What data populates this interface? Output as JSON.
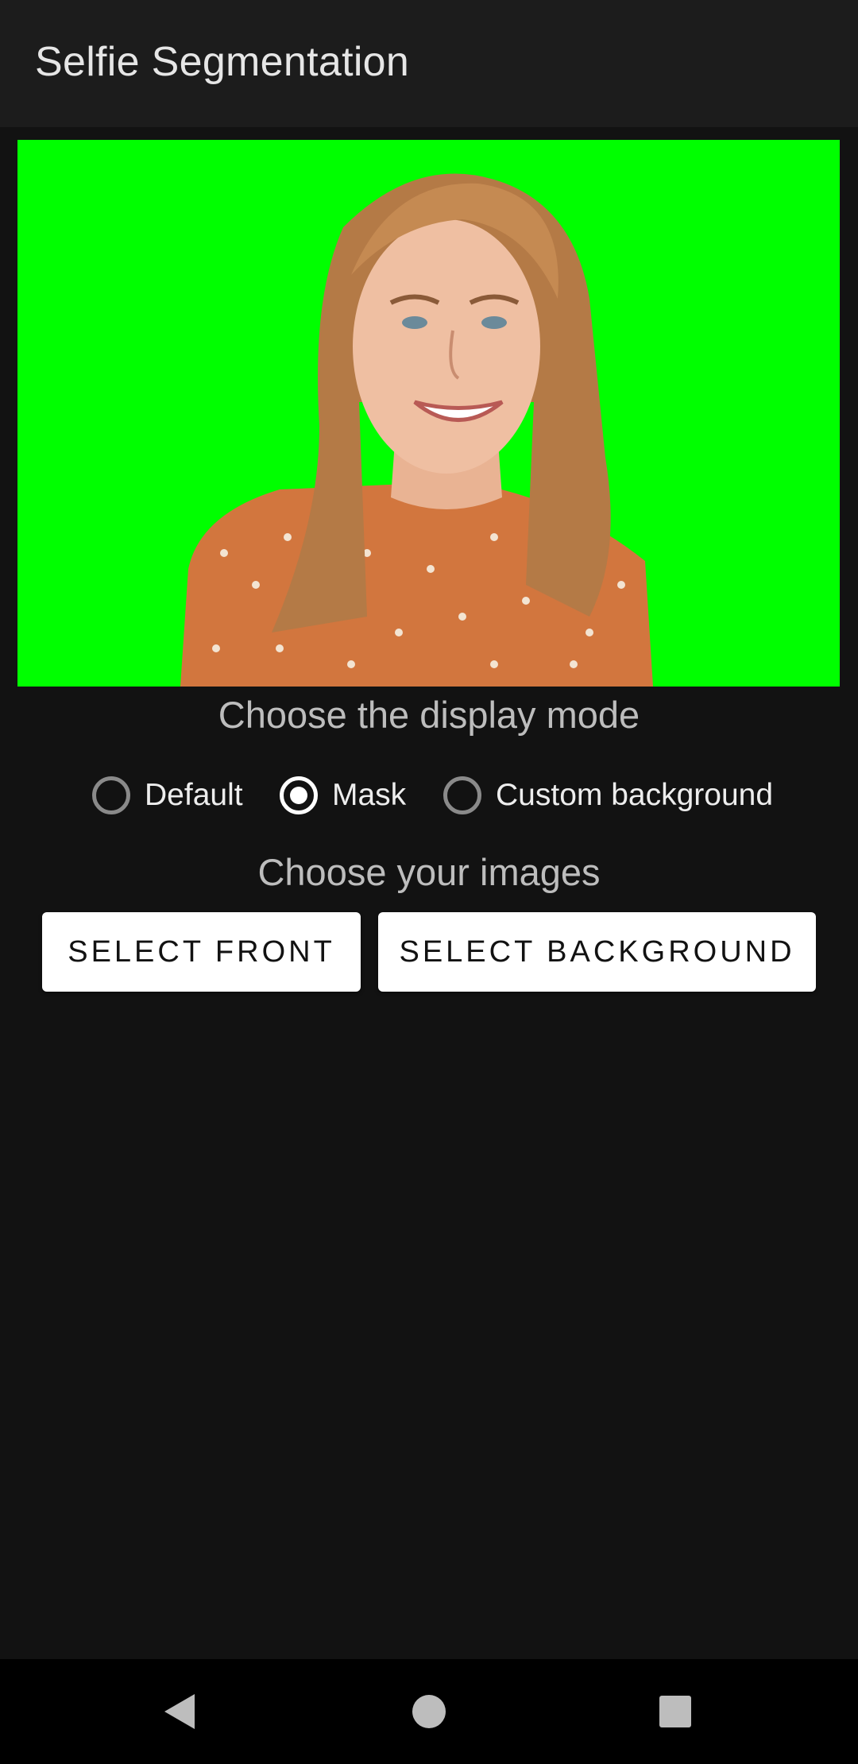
{
  "app_bar": {
    "title": "Selfie Segmentation"
  },
  "preview": {
    "background_color": "#00ff00",
    "subject": "segmented-portrait"
  },
  "display_mode": {
    "title": "Choose the display mode",
    "options": [
      {
        "label": "Default",
        "checked": false
      },
      {
        "label": "Mask",
        "checked": true
      },
      {
        "label": "Custom background",
        "checked": false
      }
    ]
  },
  "images": {
    "title": "Choose your images",
    "select_front_label": "SELECT FRONT",
    "select_background_label": "SELECT BACKGROUND"
  },
  "nav": {
    "back_icon": "back-triangle-icon",
    "home_icon": "home-circle-icon",
    "recents_icon": "recents-square-icon"
  },
  "colors": {
    "background": "#121212",
    "app_bar": "#1c1c1c",
    "button": "#ffffff",
    "accent": "#ffffff"
  }
}
